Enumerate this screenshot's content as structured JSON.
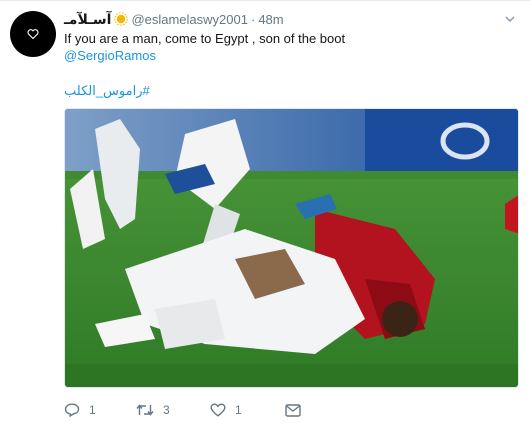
{
  "tweet": {
    "display_name": "آسـلآمـ",
    "handle": "@eslamelaswy2001",
    "separator": "·",
    "time": "48m",
    "text_line1": "If you are a man, come to Egypt , son of the boot",
    "mention": "@SergioRamos",
    "hashtag": "#راموس_الكلب",
    "media_alt": "Photo of two football players colliding on the pitch"
  },
  "actions": {
    "reply_count": "1",
    "retweet_count": "3",
    "like_count": "1"
  },
  "colors": {
    "link": "#1b95e0",
    "text": "#14171a",
    "muted": "#657786"
  }
}
